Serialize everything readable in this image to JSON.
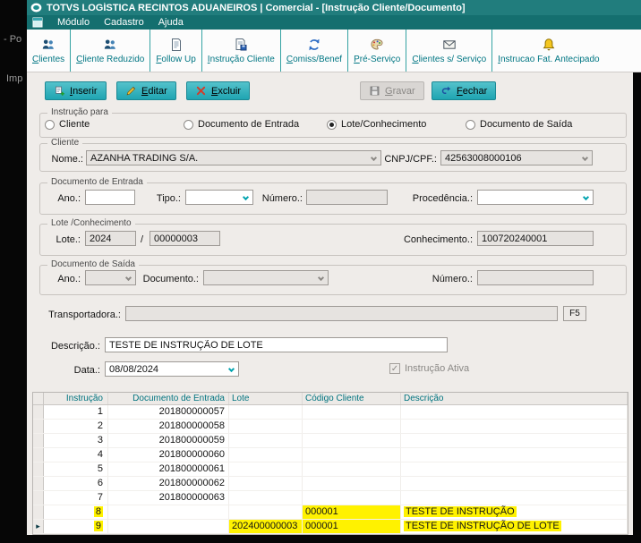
{
  "desktop": {
    "fragments": [
      "- Po",
      "Imp"
    ]
  },
  "titlebar": {
    "title": "TOTVS LOGÍSTICA RECINTOS ADUANEIROS | Comercial - [Instrução Cliente/Documento]"
  },
  "menubar": {
    "items": [
      "Módulo",
      "Cadastro",
      "Ajuda"
    ]
  },
  "toolbar": {
    "items": [
      {
        "label": "Clientes",
        "icon": "people"
      },
      {
        "label": "Cliente Reduzido",
        "icon": "people"
      },
      {
        "label": "Follow Up",
        "icon": "page"
      },
      {
        "label": "Instrução Cliente",
        "icon": "page-save"
      },
      {
        "label": "Comiss/Benef",
        "icon": "refresh"
      },
      {
        "label": "Pré-Serviço",
        "icon": "paint"
      },
      {
        "label": "Clientes s/ Serviço",
        "icon": "mail"
      },
      {
        "label": "Instrucao Fat. Antecipado",
        "icon": "bell"
      }
    ]
  },
  "actions": {
    "inserir": "Inserir",
    "editar": "Editar",
    "excluir": "Excluir",
    "gravar": "Gravar",
    "fechar": "Fechar"
  },
  "form": {
    "instrucao_para": {
      "legend": "Instrução para",
      "options": [
        {
          "label": "Cliente",
          "selected": false
        },
        {
          "label": "Documento de Entrada",
          "selected": false
        },
        {
          "label": "Lote/Conhecimento",
          "selected": true
        },
        {
          "label": "Documento de Saída",
          "selected": false
        }
      ]
    },
    "cliente": {
      "legend": "Cliente",
      "nome_label": "Nome.:",
      "nome_value": "AZANHA TRADING S/A.",
      "cnpj_label": "CNPJ/CPF.:",
      "cnpj_value": "42563008000106"
    },
    "documento_entrada": {
      "legend": "Documento de Entrada",
      "ano_label": "Ano.:",
      "ano_value": "",
      "tipo_label": "Tipo.:",
      "tipo_value": "",
      "numero_label": "Número.:",
      "numero_value": "",
      "procedencia_label": "Procedência.:",
      "procedencia_value": ""
    },
    "lote_conhecimento": {
      "legend": "Lote /Conhecimento",
      "lote_label": "Lote.:",
      "ano_value": "2024",
      "separator": "/",
      "numero_value": "00000003",
      "conhecimento_label": "Conhecimento.:",
      "conhecimento_value": "100720240001"
    },
    "documento_saida": {
      "legend": "Documento de Saída",
      "ano_label": "Ano.:",
      "ano_value": "",
      "documento_label": "Documento.:",
      "documento_value": "",
      "numero_label": "Número.:",
      "numero_value": ""
    },
    "transportadora": {
      "label": "Transportadora.:",
      "value": "",
      "f5_label": "F5"
    },
    "descricao": {
      "label": "Descrição.:",
      "value": "TESTE DE INSTRUÇÃO DE LOTE"
    },
    "data": {
      "label": "Data.:",
      "value": "08/08/2024"
    },
    "instrucao_ativa": {
      "label": "Instrução Ativa",
      "checked": true
    }
  },
  "grid": {
    "columns": [
      "Instrução",
      "Documento de Entrada",
      "Lote",
      "Código Cliente",
      "Descrição"
    ],
    "current_row_marker": "▸",
    "rows": [
      {
        "instrucao": "1",
        "doc_entrada": "201800000057",
        "lote": "",
        "codigo_cliente": "",
        "descricao": "",
        "highlight": false,
        "current": false
      },
      {
        "instrucao": "2",
        "doc_entrada": "201800000058",
        "lote": "",
        "codigo_cliente": "",
        "descricao": "",
        "highlight": false,
        "current": false
      },
      {
        "instrucao": "3",
        "doc_entrada": "201800000059",
        "lote": "",
        "codigo_cliente": "",
        "descricao": "",
        "highlight": false,
        "current": false
      },
      {
        "instrucao": "4",
        "doc_entrada": "201800000060",
        "lote": "",
        "codigo_cliente": "",
        "descricao": "",
        "highlight": false,
        "current": false
      },
      {
        "instrucao": "5",
        "doc_entrada": "201800000061",
        "lote": "",
        "codigo_cliente": "",
        "descricao": "",
        "highlight": false,
        "current": false
      },
      {
        "instrucao": "6",
        "doc_entrada": "201800000062",
        "lote": "",
        "codigo_cliente": "",
        "descricao": "",
        "highlight": false,
        "current": false
      },
      {
        "instrucao": "7",
        "doc_entrada": "201800000063",
        "lote": "",
        "codigo_cliente": "",
        "descricao": "",
        "highlight": false,
        "current": false
      },
      {
        "instrucao": "8",
        "doc_entrada": "",
        "lote": "",
        "codigo_cliente": "000001",
        "descricao": "TESTE DE INSTRUÇÃO",
        "highlight": true,
        "current": false
      },
      {
        "instrucao": "9",
        "doc_entrada": "",
        "lote": "202400000003",
        "codigo_cliente": "000001",
        "descricao": "TESTE DE INSTRUÇÃO DE LOTE",
        "highlight": true,
        "current": true
      }
    ]
  },
  "colors": {
    "titlebar": "#217D7D",
    "menubar": "#146F6F",
    "accent_teal": "#00A3AF",
    "toolbar_text": "#007683",
    "button_face": "#1FA5B2",
    "highlight": "#FFF200",
    "grid_header_text": "#00737F"
  }
}
